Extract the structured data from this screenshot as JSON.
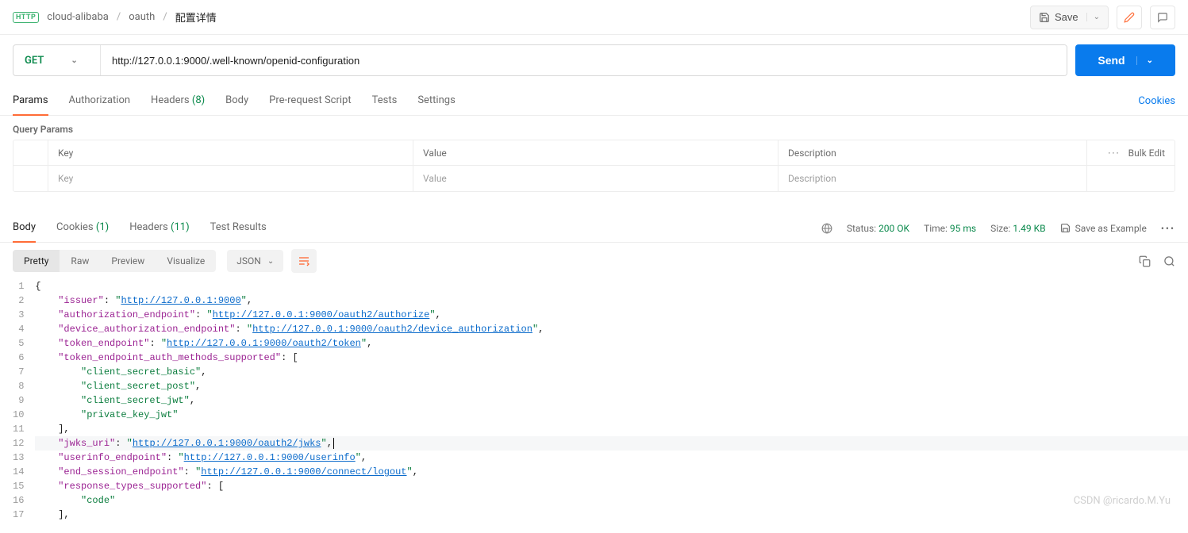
{
  "breadcrumb": {
    "badge": "HTTP",
    "items": [
      "cloud-alibaba",
      "oauth",
      "配置详情"
    ]
  },
  "top_actions": {
    "save": "Save"
  },
  "request": {
    "method": "GET",
    "url": "http://127.0.0.1:9000/.well-known/openid-configuration",
    "send": "Send"
  },
  "req_tabs": {
    "params": "Params",
    "authorization": "Authorization",
    "headers": "Headers",
    "headers_count": "(8)",
    "body": "Body",
    "prerequest": "Pre-request Script",
    "tests": "Tests",
    "settings": "Settings",
    "cookies": "Cookies"
  },
  "query_params": {
    "title": "Query Params",
    "th_key": "Key",
    "th_val": "Value",
    "th_desc": "Description",
    "ph_key": "Key",
    "ph_val": "Value",
    "ph_desc": "Description",
    "bulk_edit": "Bulk Edit"
  },
  "resp_tabs": {
    "body": "Body",
    "cookies": "Cookies",
    "cookies_count": "(1)",
    "headers": "Headers",
    "headers_count": "(11)",
    "tests": "Test Results"
  },
  "status": {
    "status_label": "Status:",
    "status_value": "200 OK",
    "time_label": "Time:",
    "time_value": "95 ms",
    "size_label": "Size:",
    "size_value": "1.49 KB",
    "save_example": "Save as Example"
  },
  "view_tabs": {
    "pretty": "Pretty",
    "raw": "Raw",
    "preview": "Preview",
    "visualize": "Visualize",
    "format": "JSON"
  },
  "code": {
    "k_issuer": "issuer",
    "u_issuer": "http://127.0.0.1:9000",
    "k_auth": "authorization_endpoint",
    "u_auth": "http://127.0.0.1:9000/oauth2/authorize",
    "k_devauth": "device_authorization_endpoint",
    "u_devauth": "http://127.0.0.1:9000/oauth2/device_authorization",
    "k_token": "token_endpoint",
    "u_token": "http://127.0.0.1:9000/oauth2/token",
    "k_teams": "token_endpoint_auth_methods_supported",
    "m1": "client_secret_basic",
    "m2": "client_secret_post",
    "m3": "client_secret_jwt",
    "m4": "private_key_jwt",
    "k_jwks": "jwks_uri",
    "u_jwks": "http://127.0.0.1:9000/oauth2/jwks",
    "k_userinfo": "userinfo_endpoint",
    "u_userinfo": "http://127.0.0.1:9000/userinfo",
    "k_endsess": "end_session_endpoint",
    "u_endsess": "http://127.0.0.1:9000/connect/logout",
    "k_rts": "response_types_supported",
    "rt1": "code",
    "line_count": 17
  },
  "watermark": "CSDN @ricardo.M.Yu"
}
